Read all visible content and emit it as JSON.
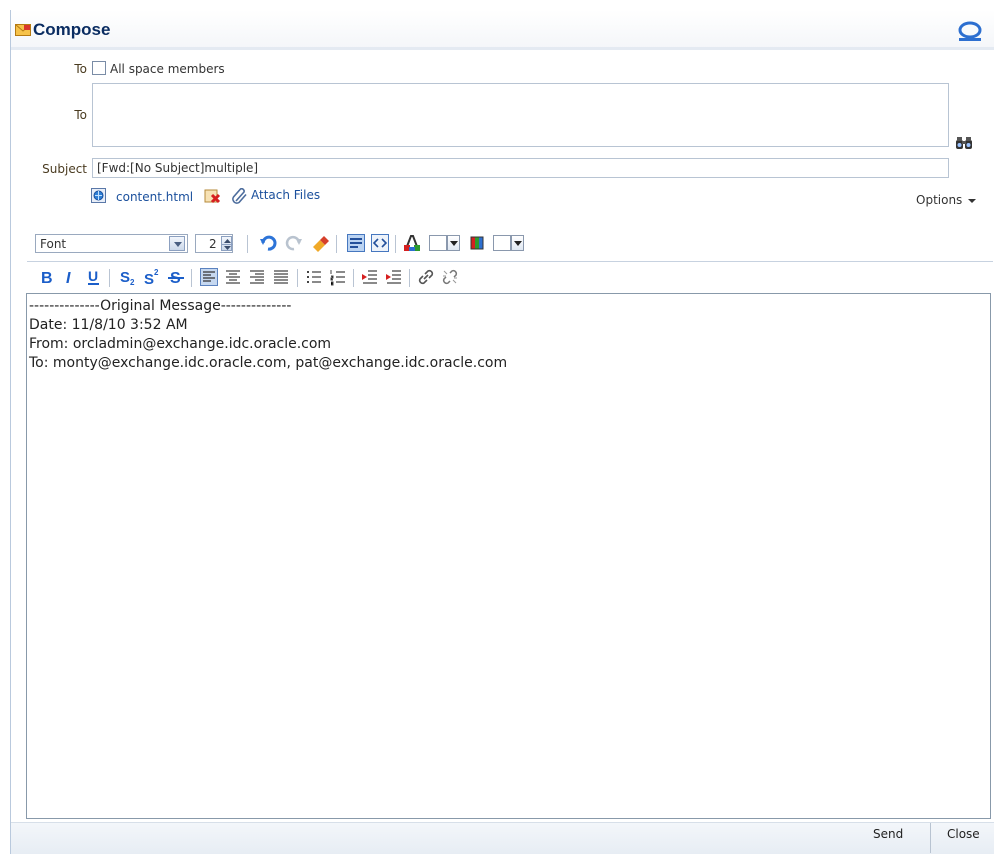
{
  "header": {
    "title": "Compose",
    "compose_icon": "envelope-icon",
    "brand_icon": "oracle-logo-icon"
  },
  "form": {
    "to_label": "To",
    "all_members_label": "All space members",
    "all_members_checked": false,
    "to2_label": "To",
    "to_value": "",
    "subject_label": "Subject",
    "subject_value": "[Fwd:[No Subject]multiple]",
    "attachment_name": "content.html",
    "attach_label": "Attach Files",
    "options_label": "Options"
  },
  "toolbar": {
    "font_value": "Font",
    "size_value": "2",
    "row1_icons": [
      "undo-icon",
      "redo-icon",
      "eraser-icon",
      "rich-text-mode-icon",
      "source-mode-icon",
      "text-color-icon",
      "background-color-icon"
    ],
    "row2_icons": [
      "bold-icon",
      "italic-icon",
      "underline-icon",
      "subscript-icon",
      "superscript-icon",
      "strikethrough-icon",
      "align-left-icon",
      "align-center-icon",
      "align-right-icon",
      "justify-icon",
      "bullet-list-icon",
      "numbered-list-icon",
      "outdent-icon",
      "indent-icon",
      "link-icon",
      "unlink-icon"
    ]
  },
  "editor": {
    "lines": [
      "--------------Original Message--------------",
      "Date: 11/8/10 3:52 AM",
      "From: orcladmin@exchange.idc.oracle.com",
      "To: monty@exchange.idc.oracle.com, pat@exchange.idc.oracle.com"
    ]
  },
  "footer": {
    "send_label": "Send",
    "close_label": "Close"
  },
  "colors": {
    "title": "#0a2c61",
    "link": "#1a4f9c",
    "label": "#4a3b20",
    "accent_blue": "#1b5ec9"
  }
}
